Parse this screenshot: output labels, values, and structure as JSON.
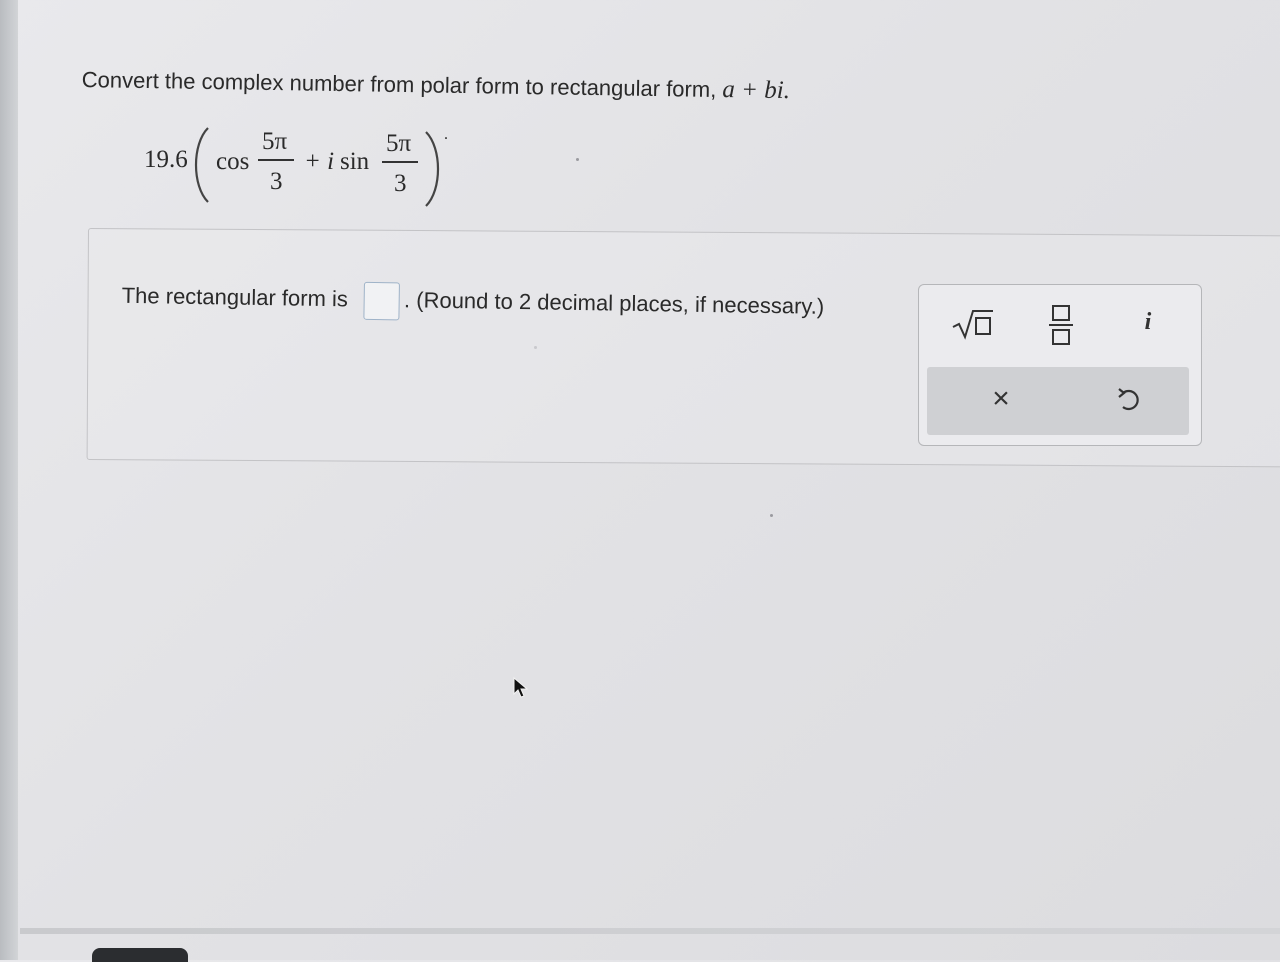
{
  "question": {
    "text": "Convert the complex number from polar form to rectangular form,",
    "form_expression": "a + bi",
    "form_period": "."
  },
  "expression": {
    "modulus": "19.6",
    "cos": "cos",
    "plus_i": "+ i",
    "sin": "sin",
    "numerator": "5π",
    "denominator": "3",
    "trailing_period": "."
  },
  "answer": {
    "prefix": "The rectangular form is",
    "suffix": ". (Round to 2 decimal places, if necessary.)",
    "value": ""
  },
  "keypad": {
    "sqrt_icon": "sqrt-template-icon",
    "fraction_icon": "fraction-template-icon",
    "i_label": "i",
    "clear_label": "×",
    "undo_icon": "undo-icon"
  }
}
